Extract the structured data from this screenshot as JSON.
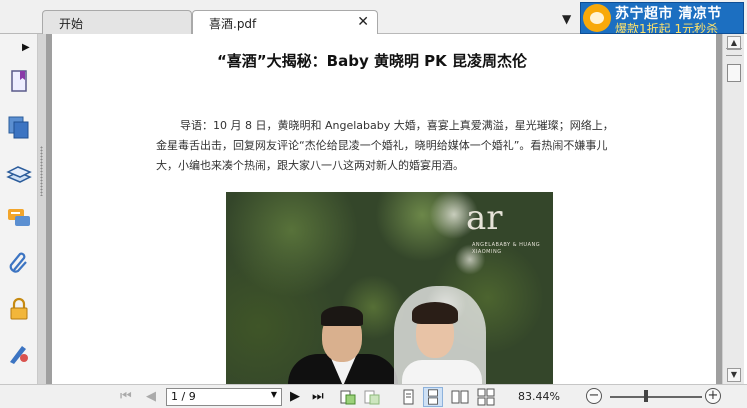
{
  "tabs": [
    {
      "label": "开始"
    },
    {
      "label": "喜酒.pdf"
    }
  ],
  "ad": {
    "line1": "苏宁超市 清凉节",
    "line2": "爆款1折起 1元秒杀",
    "brand_color": "#1c6fc1"
  },
  "left_tools": [
    "bookmarks-icon",
    "pages-icon",
    "layers-icon",
    "comments-icon",
    "attachments-icon",
    "security-icon",
    "signatures-icon"
  ],
  "document": {
    "title": "“喜酒”大揭秘：Baby 黄晓明 PK 昆凌周杰伦",
    "intro": "导语：10 月 8 日，黄晓明和 Angelababy 大婚，喜宴上真爱满溢，星光璀璨；网络上，金星毒舌出击，回复网友评论“杰伦给昆凌一个婚礼，晓明给媒体一个婚礼”。看热闹不嫌事儿大，小编也来凑个热闹，跟大家八一八这两对新人的婚宴用酒。",
    "photo_logo": "ar",
    "photo_caption": "ANGELABABY & HUANG XIAOMING"
  },
  "nav": {
    "page_value": "1 / 9",
    "zoom": "83.44%"
  }
}
